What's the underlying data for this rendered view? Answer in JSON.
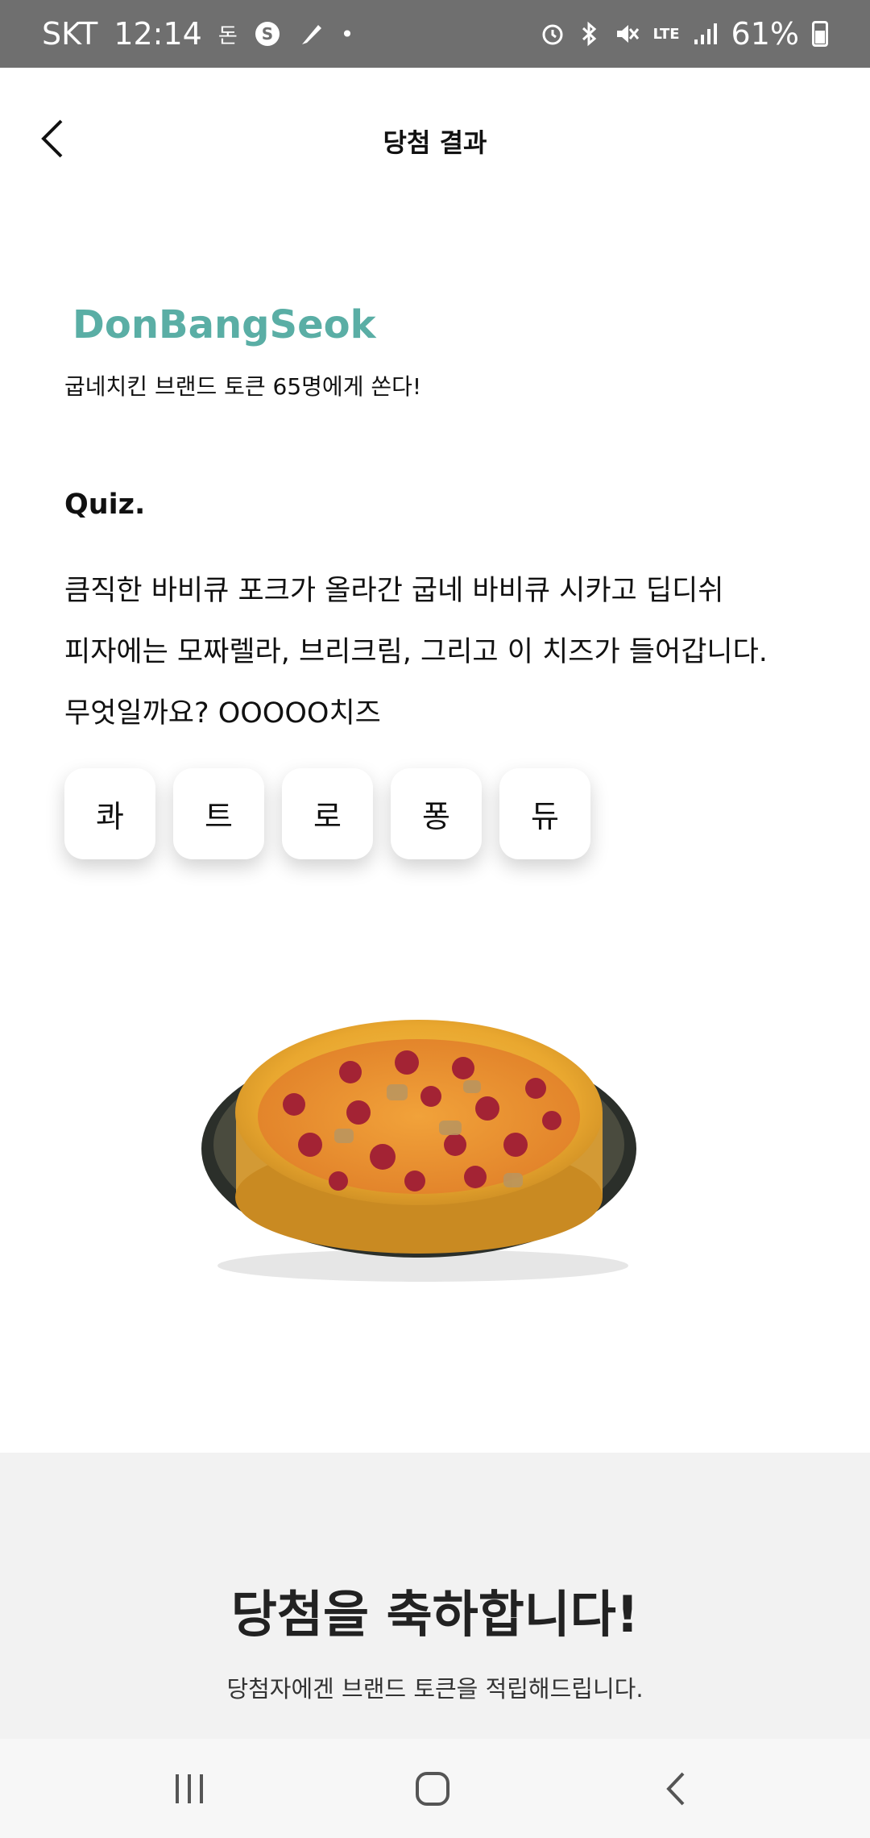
{
  "status_bar": {
    "carrier": "SKT",
    "time": "12:14",
    "notif_text": "돈",
    "dot": "•",
    "battery": "61%",
    "network": "LTE",
    "icons": [
      "s-icon",
      "feather-icon",
      "alarm-icon",
      "bluetooth-icon",
      "mute-icon",
      "signal-icon",
      "battery-icon"
    ]
  },
  "header": {
    "title": "당첨 결과"
  },
  "brand": {
    "name": "DonBangSeok",
    "color": "#5aaea5"
  },
  "subtitle": "굽네치킨 브랜드 토큰 65명에게 쏜다!",
  "quiz": {
    "label": "Quiz.",
    "lines": [
      "큼직한 바비큐 포크가 올라간 굽네 바비큐 시카고 딥디쉬",
      "피자에는 모짜렐라, 브리크림, 그리고 이 치즈가 들어갑니다.",
      "무엇일까요? OOOOO치즈"
    ],
    "choices": [
      "콰",
      "트",
      "로",
      "퐁",
      "듀"
    ]
  },
  "result": {
    "title": "당첨을 축하합니다!",
    "subtitle": "당첨자에겐 브랜드 토큰을 적립해드립니다."
  },
  "navbar": {
    "icons": [
      "recents-icon",
      "home-icon",
      "back-icon"
    ]
  }
}
